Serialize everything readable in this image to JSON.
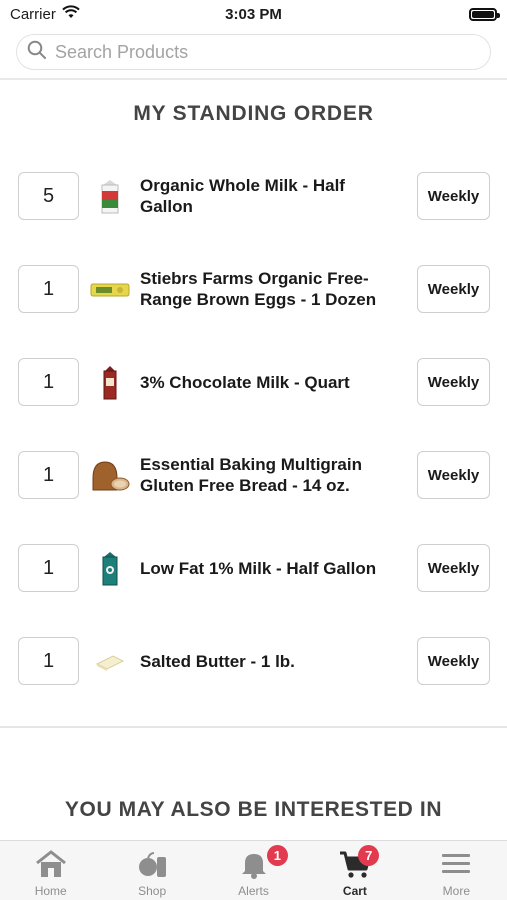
{
  "status_bar": {
    "carrier": "Carrier",
    "time": "3:03 PM"
  },
  "search": {
    "placeholder": "Search Products"
  },
  "standing_order": {
    "title": "MY STANDING ORDER",
    "items": [
      {
        "qty": "5",
        "name": "Organic Whole Milk - Half Gallon",
        "frequency": "Weekly",
        "thumb": "milk-carton-icon"
      },
      {
        "qty": "1",
        "name": "Stiebrs Farms Organic Free-Range Brown Eggs - 1 Dozen",
        "frequency": "Weekly",
        "thumb": "egg-carton-icon"
      },
      {
        "qty": "1",
        "name": "3% Chocolate Milk - Quart",
        "frequency": "Weekly",
        "thumb": "chocolate-milk-icon"
      },
      {
        "qty": "1",
        "name": "Essential Baking Multigrain Gluten Free Bread - 14 oz.",
        "frequency": "Weekly",
        "thumb": "bread-icon"
      },
      {
        "qty": "1",
        "name": "Low Fat 1% Milk - Half Gallon",
        "frequency": "Weekly",
        "thumb": "milk-carton-icon"
      },
      {
        "qty": "1",
        "name": "Salted Butter - 1 lb.",
        "frequency": "Weekly",
        "thumb": "butter-icon"
      }
    ]
  },
  "recommendations": {
    "title": "YOU MAY ALSO BE INTERESTED IN"
  },
  "tab_bar": {
    "items": [
      {
        "label": "Home",
        "icon": "home-icon"
      },
      {
        "label": "Shop",
        "icon": "shop-icon"
      },
      {
        "label": "Alerts",
        "icon": "bell-icon",
        "badge": "1"
      },
      {
        "label": "Cart",
        "icon": "cart-icon",
        "badge": "7",
        "active": true
      },
      {
        "label": "More",
        "icon": "menu-icon"
      }
    ]
  },
  "colors": {
    "badge": "#e23a4f",
    "accent": "#2b2b2b"
  }
}
